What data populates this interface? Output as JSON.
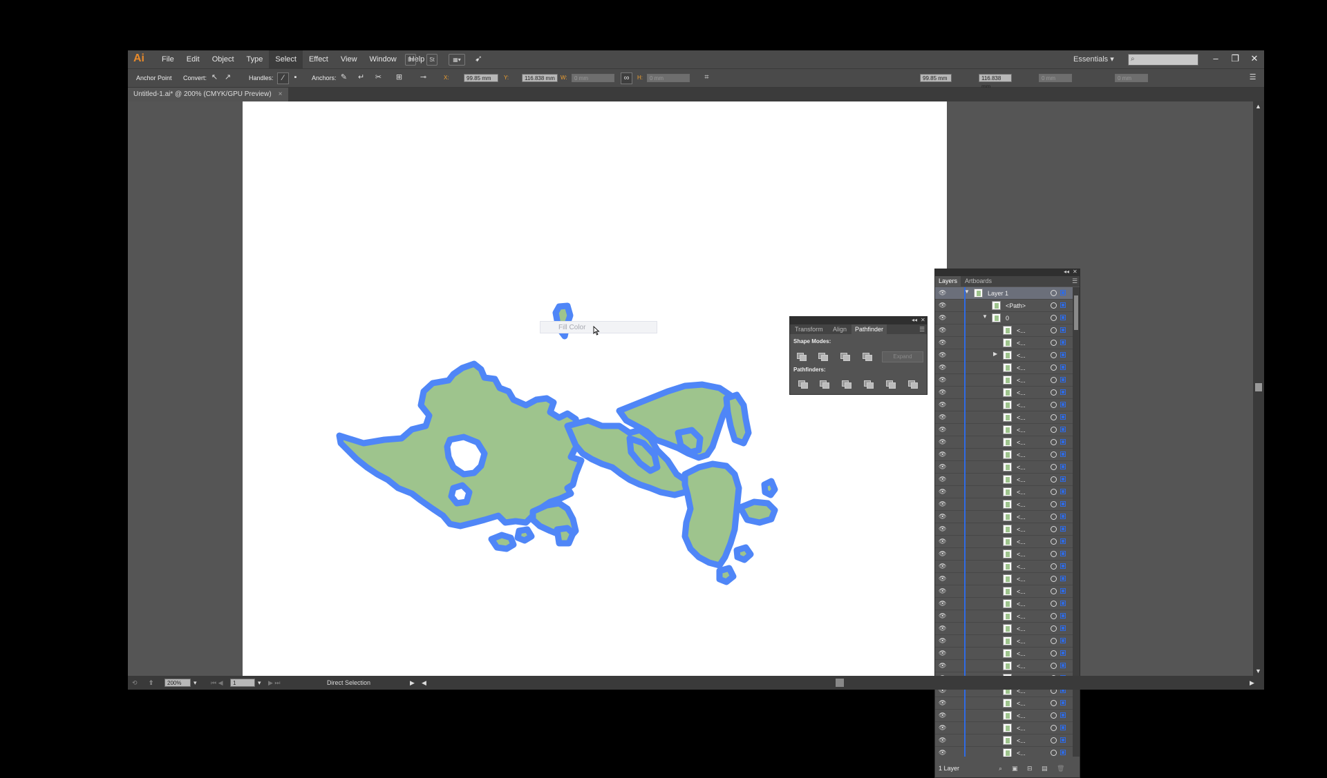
{
  "app": {
    "logo": "Ai",
    "menu": [
      "File",
      "Edit",
      "Object",
      "Type",
      "Select",
      "Effect",
      "View",
      "Window",
      "Help"
    ],
    "active_menu": "Select",
    "bridge_btn": "Br",
    "stock_btn": "St",
    "workspace": "Essentials"
  },
  "control_bar": {
    "tool_label": "Anchor Point",
    "convert_label": "Convert:",
    "handles_label": "Handles:",
    "anchors_label": "Anchors:",
    "x_label": "X:",
    "x_value": "99.85 mm",
    "y_label": "Y:",
    "y_value": "116.838 mm",
    "w_label": "W:",
    "w_value": "0 mm",
    "h_label": "H:",
    "h_value": "0 mm",
    "right_x": "99.85 mm",
    "right_y": "116.838 mm",
    "right_w": "0 mm",
    "right_h": "0 mm"
  },
  "document": {
    "tab_title": "Untitled-1.ai* @ 200% (CMYK/GPU Preview)",
    "close": "×"
  },
  "tooltip": {
    "text": "Fill Color"
  },
  "pathfinder_panel": {
    "tabs": [
      "Transform",
      "Align",
      "Pathfinder"
    ],
    "active_tab": "Pathfinder",
    "shape_modes_label": "Shape Modes:",
    "pathfinders_label": "Pathfinders:",
    "expand_label": "Expand"
  },
  "layers_panel": {
    "tabs": [
      "Layers",
      "Artboards"
    ],
    "active_tab": "Layers",
    "rows": [
      {
        "name": "Layer 1",
        "level": 0,
        "expanded": true,
        "selected": true
      },
      {
        "name": "<Path>",
        "level": 1
      },
      {
        "name": "0",
        "level": 1,
        "expanded": true
      },
      {
        "name": "<...",
        "level": 2
      },
      {
        "name": "<...",
        "level": 2
      },
      {
        "name": "<...",
        "level": 2,
        "collapsed": true
      },
      {
        "name": "<...",
        "level": 2
      },
      {
        "name": "<...",
        "level": 2
      },
      {
        "name": "<...",
        "level": 2
      },
      {
        "name": "<...",
        "level": 2
      },
      {
        "name": "<...",
        "level": 2
      },
      {
        "name": "<...",
        "level": 2
      },
      {
        "name": "<...",
        "level": 2
      },
      {
        "name": "<...",
        "level": 2
      },
      {
        "name": "<...",
        "level": 2
      },
      {
        "name": "<...",
        "level": 2
      },
      {
        "name": "<...",
        "level": 2
      },
      {
        "name": "<...",
        "level": 2
      },
      {
        "name": "<...",
        "level": 2
      },
      {
        "name": "<...",
        "level": 2
      },
      {
        "name": "<...",
        "level": 2
      },
      {
        "name": "<...",
        "level": 2
      },
      {
        "name": "<...",
        "level": 2
      },
      {
        "name": "<...",
        "level": 2
      },
      {
        "name": "<...",
        "level": 2
      },
      {
        "name": "<...",
        "level": 2
      },
      {
        "name": "<...",
        "level": 2
      },
      {
        "name": "<...",
        "level": 2
      },
      {
        "name": "<...",
        "level": 2
      },
      {
        "name": "<...",
        "level": 2
      },
      {
        "name": "<...",
        "level": 2
      },
      {
        "name": "<...",
        "level": 2
      },
      {
        "name": "<...",
        "level": 2
      },
      {
        "name": "<...",
        "level": 2
      },
      {
        "name": "<...",
        "level": 2
      },
      {
        "name": "<...",
        "level": 2
      },
      {
        "name": "<...",
        "level": 2
      },
      {
        "name": "<...",
        "level": 2
      }
    ],
    "footer_count": "1 Layer"
  },
  "status_bar": {
    "zoom": "200%",
    "artboard": "1",
    "tool_status": "Direct Selection"
  },
  "colors": {
    "map_fill": "#9ec48d",
    "map_stroke": "#4f86f7",
    "selection_blue": "#2e6be6",
    "ai_orange": "#e88a2b"
  }
}
